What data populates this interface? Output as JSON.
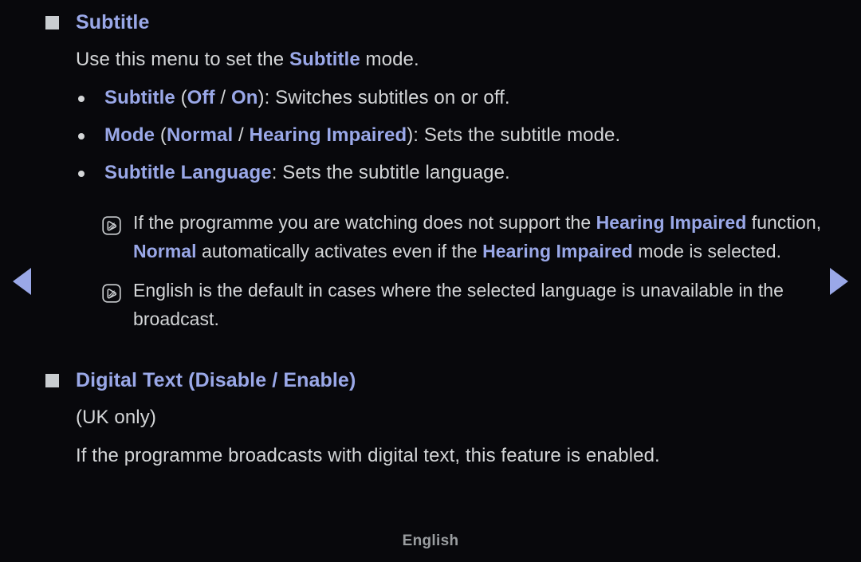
{
  "page": {
    "background_color": "#08080c",
    "accent_color": "#9aa8e8",
    "text_color": "#d4d6d8",
    "footer_label": "English"
  },
  "sections": [
    {
      "heading": {
        "title": "Subtitle",
        "bullet_icon": "filled-square-bullet"
      },
      "intro": {
        "before": "Use this menu to set the ",
        "emphasis": "Subtitle",
        "after": " mode."
      },
      "bullets": [
        {
          "term": "Subtitle",
          "open_paren": " (",
          "option_one": "Off",
          "separator": " / ",
          "option_two": "On",
          "close_paren": ")",
          "description": ": Switches subtitles on or off."
        },
        {
          "term": "Mode",
          "open_paren": " (",
          "option_one": "Normal",
          "separator": " / ",
          "option_two": "Hearing Impaired",
          "close_paren": ")",
          "description": ": Sets the subtitle mode."
        },
        {
          "term": "Subtitle Language",
          "open_paren": "",
          "option_one": "",
          "separator": "",
          "option_two": "",
          "close_paren": "",
          "description": ": Sets the subtitle language."
        }
      ],
      "notes": [
        {
          "icon": "note-pen-icon",
          "part_1": "If the programme you are watching does not support the ",
          "emph_1": "Hearing Impaired",
          "part_2": " function, ",
          "emph_2": "Normal",
          "part_3": " automatically activates even if the ",
          "emph_3": "Hearing Impaired",
          "part_4": " mode is selected."
        },
        {
          "icon": "note-pen-icon",
          "part_1": "English is the default in cases where the selected language is unavailable in the broadcast.",
          "emph_1": "",
          "part_2": "",
          "emph_2": "",
          "part_3": "",
          "emph_3": "",
          "part_4": ""
        }
      ]
    },
    {
      "heading": {
        "title": "Digital Text",
        "open_paren": " (",
        "option_one": "Disable",
        "separator": " / ",
        "option_two": "Enable",
        "close_paren": ")",
        "bullet_icon": "filled-square-bullet"
      },
      "region_note": "(UK only)",
      "body": "If the programme broadcasts with digital text, this feature is enabled."
    }
  ],
  "navigation": {
    "previous_label": "previous-page",
    "next_label": "next-page"
  }
}
